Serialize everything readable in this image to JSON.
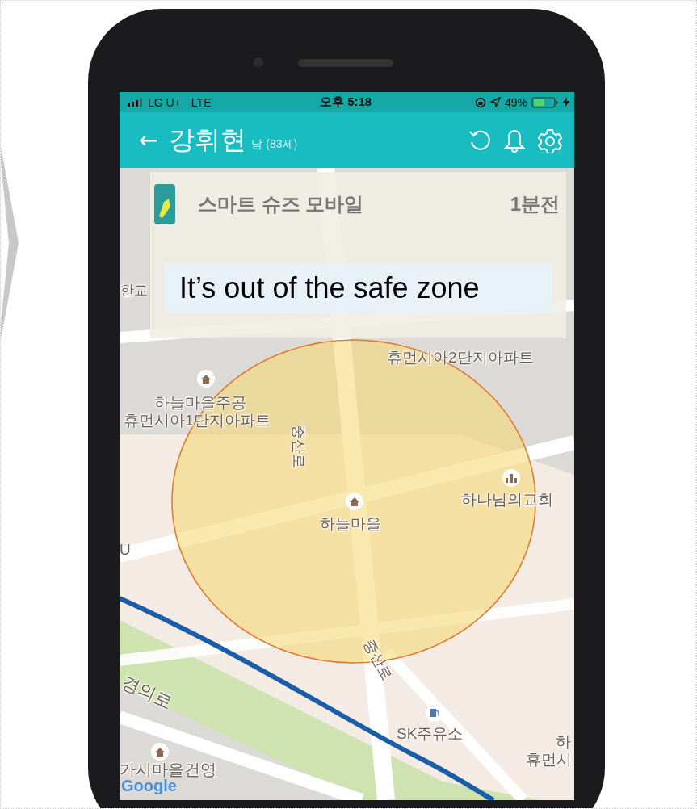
{
  "status_bar": {
    "carrier": "LG U+",
    "network": "LTE",
    "time": "오후 5:18",
    "battery": "49%"
  },
  "header": {
    "back": "←",
    "name": "강휘현",
    "info": "남 (83세)"
  },
  "notification": {
    "app": "스마트 슈즈 모바일",
    "time": "1분전",
    "message": "It’s out of the safe zone"
  },
  "map": {
    "labels": [
      {
        "text": "한교"
      },
      {
        "text": "휴먼시아2단지아파트"
      },
      {
        "text": "하늘마을주공"
      },
      {
        "text": "휴먼시아1단지아파트"
      },
      {
        "text": "중산로"
      },
      {
        "text": "하나님의교회"
      },
      {
        "text": "하늘마을"
      },
      {
        "text": "U"
      },
      {
        "text": "중산로"
      },
      {
        "text": "경의로"
      },
      {
        "text": "SK주유소"
      },
      {
        "text": "하"
      },
      {
        "text": "휴먼시"
      },
      {
        "text": "가시마을건영"
      }
    ],
    "attribution": "Google"
  }
}
